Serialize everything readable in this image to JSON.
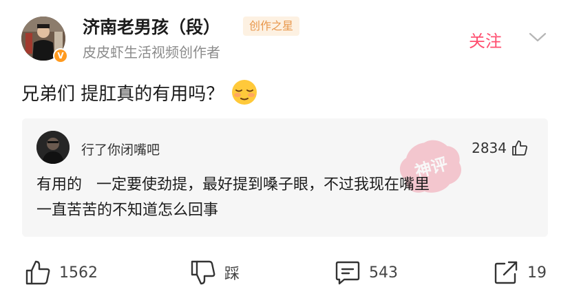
{
  "user": {
    "name": "济南老男孩（段）",
    "badge": "创作之星",
    "subtitle": "皮皮虾生活视频创作者",
    "verified_mark": "V",
    "follow_label": "关注"
  },
  "post": {
    "text": "兄弟们 提肛真的有用吗？",
    "emoji": "relieved-face-emoji"
  },
  "comment": {
    "author": "行了你闭嘴吧",
    "likes": "2834",
    "lines": [
      "有用的   一定要使劲提，最好提到嗓子眼，不过我现在嘴里",
      "一直苦苦的不知道怎么回事"
    ],
    "stamp_text": "神评"
  },
  "actions": {
    "like_count": "1562",
    "dislike_label": "踩",
    "comment_count": "543",
    "share_count": "19"
  },
  "colors": {
    "accent": "#ff4f70",
    "badge_text": "#e8974b",
    "badge_bg": "#fdf1e2",
    "verified": "#ff9a1f",
    "card_bg": "#f6f6f6"
  },
  "icons": [
    "chevron-down-icon",
    "thumbs-up-icon",
    "thumbs-down-icon",
    "comment-bubble-icon",
    "share-icon",
    "verified-icon"
  ]
}
